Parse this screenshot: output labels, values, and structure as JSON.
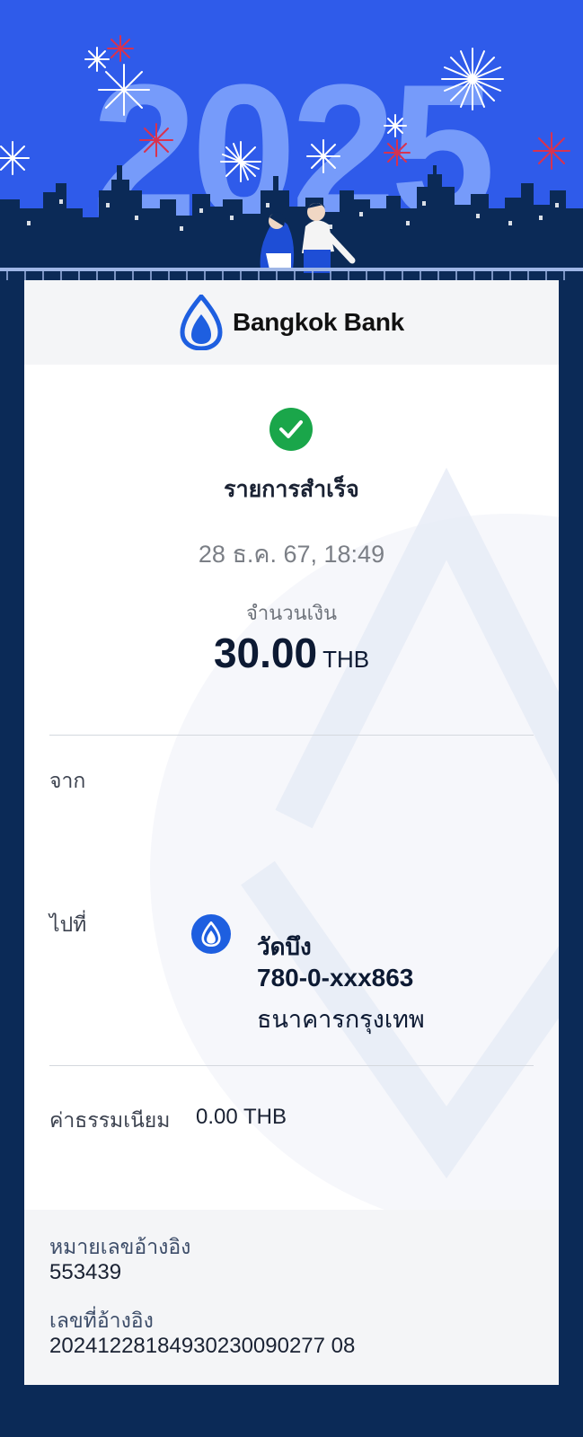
{
  "banner": {
    "year": "2025"
  },
  "brand": {
    "name": "Bangkok Bank",
    "icon": "bangkok-bank-lotus-icon",
    "color": "#1e5fe0"
  },
  "status": {
    "icon": "check-circle-icon",
    "title": "รายการสำเร็จ",
    "color": "#1aa64a"
  },
  "transaction": {
    "datetime": "28 ธ.ค. 67, 18:49",
    "amount_label": "จำนวนเงิน",
    "amount": "30.00",
    "currency": "THB"
  },
  "from": {
    "label": "จาก"
  },
  "to": {
    "label": "ไปที่",
    "name": "วัดบึง",
    "account": "780-0-xxx863",
    "bank": "ธนาคารกรุงเทพ"
  },
  "fee": {
    "label": "ค่าธรรมเนียม",
    "value": "0.00 THB"
  },
  "reference": {
    "ref_number_label": "หมายเลขอ้างอิง",
    "ref_number": "553439",
    "ref_id_label": "เลขที่อ้างอิง",
    "ref_id": "20241228184930230090277 08"
  },
  "colors": {
    "banner_bg": "#2f5bea",
    "skyline": "#0b2a57",
    "page_bg": "#0b2a57"
  }
}
